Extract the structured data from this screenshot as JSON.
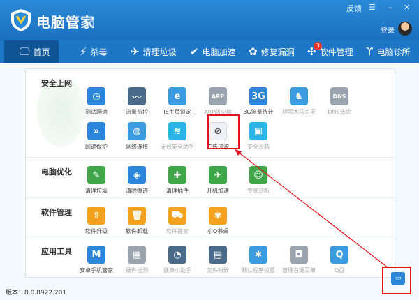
{
  "app": {
    "title": "电脑管家",
    "squiggle": "ฮ"
  },
  "window_controls": {
    "feedback": "反馈",
    "menu": "☰",
    "minimize": "–",
    "close": "✕"
  },
  "user": {
    "login": "登录"
  },
  "nav": {
    "tabs": [
      {
        "label": "首页",
        "icon": "monitor-icon",
        "glyph": "🖵"
      },
      {
        "label": "杀毒",
        "icon": "lightning-icon",
        "glyph": "⚡"
      },
      {
        "label": "清理垃圾",
        "icon": "broom-icon",
        "glyph": "✈"
      },
      {
        "label": "电脑加速",
        "icon": "rocket-icon",
        "glyph": "✔"
      },
      {
        "label": "修复漏洞",
        "icon": "repair-icon",
        "glyph": "✿"
      },
      {
        "label": "软件管理",
        "icon": "software-icon",
        "glyph": "✣"
      },
      {
        "label": "电脑诊所",
        "icon": "stethoscope-icon",
        "glyph": "ϒ"
      }
    ],
    "software_badge": "3"
  },
  "sections": [
    {
      "title": "安全上网",
      "items": [
        {
          "label": "测试网速",
          "icon": "speedometer-icon",
          "glyph": "◷",
          "color": "c-blue"
        },
        {
          "label": "流量监控",
          "icon": "traffic-chart-icon",
          "glyph": "〰",
          "color": "c-steel"
        },
        {
          "label": "IE主页锁定",
          "icon": "ie-icon",
          "glyph": "e",
          "color": "c-lblue"
        },
        {
          "label": "ARP防火墙",
          "icon": "arp-icon",
          "glyph": "ARP",
          "color": "c-gray",
          "dim": true
        },
        {
          "label": "3G流量统计",
          "icon": "3g-icon",
          "glyph": "3G",
          "color": "c-blue"
        },
        {
          "label": "顽固木马克星",
          "icon": "horse-icon",
          "glyph": "♞",
          "color": "c-lblue",
          "dim": true
        },
        {
          "label": "DNS选优",
          "icon": "dns-icon",
          "glyph": "DNS",
          "color": "c-gray",
          "dim": true
        },
        {
          "label": "网速保护",
          "icon": "shield-arrow-icon",
          "glyph": "»",
          "color": "c-blue"
        },
        {
          "label": "网络连接",
          "icon": "globe-icon",
          "glyph": "◍",
          "color": "c-lblue"
        },
        {
          "label": "无线安全助手",
          "icon": "wifi-icon",
          "glyph": "≋",
          "color": "c-cyan",
          "dim": true
        },
        {
          "label": "广告过滤",
          "icon": "ad-filter-icon",
          "glyph": "⊘",
          "color": "c-white"
        },
        {
          "label": "安全沙箱",
          "icon": "sandbox-icon",
          "glyph": "▣",
          "color": "c-cyan",
          "dim": true
        }
      ]
    },
    {
      "title": "电脑优化",
      "items": [
        {
          "label": "清理垃圾",
          "icon": "broom-icon",
          "glyph": "✎",
          "color": "c-green"
        },
        {
          "label": "清除痕迹",
          "icon": "eraser-icon",
          "glyph": "◈",
          "color": "c-blue"
        },
        {
          "label": "清理插件",
          "icon": "plugin-icon",
          "glyph": "✚",
          "color": "c-green"
        },
        {
          "label": "开机加速",
          "icon": "rocket-icon",
          "glyph": "✈",
          "color": "c-green"
        },
        {
          "label": "专家诊断",
          "icon": "doctor-icon",
          "glyph": "☺",
          "color": "c-green",
          "dim": true
        }
      ]
    },
    {
      "title": "软件管理",
      "items": [
        {
          "label": "软件升级",
          "icon": "upgrade-icon",
          "glyph": "⇧",
          "color": "c-orange"
        },
        {
          "label": "软件卸载",
          "icon": "trash-icon",
          "glyph": "🗑",
          "color": "c-orange"
        },
        {
          "label": "软件搬家",
          "icon": "truck-icon",
          "glyph": "⛟",
          "color": "c-orange",
          "dim": true
        },
        {
          "label": "小Q书桌",
          "icon": "qdesk-icon",
          "glyph": "✾",
          "color": "c-orange"
        }
      ]
    },
    {
      "title": "应用工具",
      "items": [
        {
          "label": "安卓手机管家",
          "icon": "android-icon",
          "glyph": "M",
          "color": "c-blue"
        },
        {
          "label": "硬件检测",
          "icon": "hardware-icon",
          "glyph": "▦",
          "color": "c-gray",
          "dim": true
        },
        {
          "label": "健康小助手",
          "icon": "clock-icon",
          "glyph": "◔",
          "color": "c-steel",
          "dim": true
        },
        {
          "label": "文件粉碎",
          "icon": "shredder-icon",
          "glyph": "▤",
          "color": "c-steel",
          "dim": true
        },
        {
          "label": "默认程序设置",
          "icon": "gear-icon",
          "glyph": "✱",
          "color": "c-lblue",
          "dim": true
        },
        {
          "label": "管理右键菜单",
          "icon": "mouse-icon",
          "glyph": "◘",
          "color": "c-gray",
          "dim": true
        },
        {
          "label": "Q盘",
          "icon": "qdisk-icon",
          "glyph": "Q",
          "color": "c-lblue",
          "dim": true
        }
      ]
    }
  ],
  "status": {
    "version": "版本：8.0.8922.201"
  },
  "tray": {
    "icon": "toolbox-icon",
    "glyph": "▭"
  },
  "colors": {
    "title_bar": "#1a6fc0",
    "nav_bar": "#1d76c6",
    "highlight": "#e0141a"
  }
}
